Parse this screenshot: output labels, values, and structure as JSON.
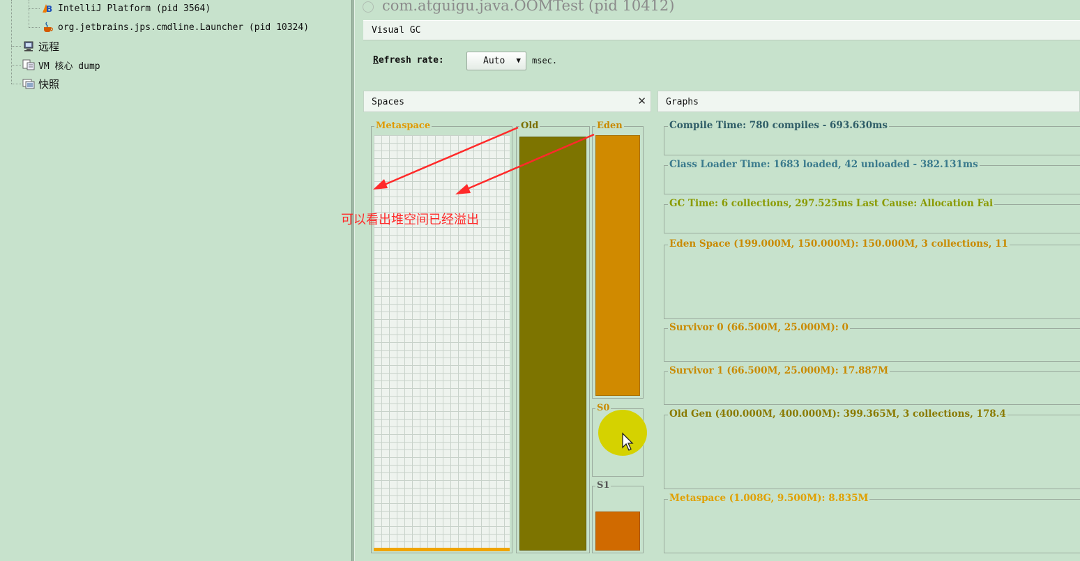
{
  "tree": {
    "items": [
      {
        "label": "IntelliJ Platform  (pid 3564)",
        "icon": "intellij-icon"
      },
      {
        "label": "org.jetbrains.jps.cmdline.Launcher  (pid 10324)",
        "icon": "java-cup-icon"
      },
      {
        "label": "远程",
        "icon": "remote-host-icon"
      },
      {
        "label": "VM 核心 dump",
        "icon": "core-dump-icon"
      },
      {
        "label": "快照",
        "icon": "snapshot-icon"
      }
    ]
  },
  "app": {
    "title": "com.atguigu.java.OOMTest  (pid 10412)",
    "tab": "Visual GC",
    "refresh": {
      "label_first": "R",
      "label_rest": "efresh rate:",
      "value": "Auto",
      "unit": "msec."
    }
  },
  "spaces": {
    "header": "Spaces",
    "close": "✕",
    "metaspace": {
      "label": "Metaspace",
      "fill_fraction": 0.01
    },
    "old": {
      "label": "Old",
      "fill_fraction": 1.0
    },
    "eden": {
      "label": "Eden",
      "fill_fraction": 1.0
    },
    "s0": {
      "label": "S0",
      "fill_fraction": 0.0
    },
    "s1": {
      "label": "S1",
      "fill_fraction": 0.72
    }
  },
  "graphs": {
    "header": "Graphs",
    "items": [
      {
        "label": "Compile Time: 780 compiles - 693.630ms",
        "color": "#2f5d67"
      },
      {
        "label": "Class Loader Time: 1683 loaded, 42 unloaded - 382.131ms",
        "color": "#3a7a8c"
      },
      {
        "label": "GC Time: 6 collections, 297.525ms Last Cause: Allocation Fai",
        "color": "#8a9a00"
      },
      {
        "label": "Eden Space (199.000M, 150.000M): 150.000M, 3 collections, 11",
        "color": "#c98a00"
      },
      {
        "label": "Survivor 0 (66.500M, 25.000M): 0",
        "color": "#c98a00"
      },
      {
        "label": "Survivor 1 (66.500M, 25.000M): 17.887M",
        "color": "#c98a00"
      },
      {
        "label": "Old Gen (400.000M, 400.000M): 399.365M, 3 collections, 178.4",
        "color": "#8a7a00"
      },
      {
        "label": "Metaspace (1.008G, 9.500M): 8.835M",
        "color": "#e0a000"
      }
    ]
  },
  "annotation": {
    "text": "可以看出堆空间已经溢出",
    "color": "#ff2a2a"
  },
  "colors": {
    "background": "#c7e2cc",
    "old_fill": "#7d7400",
    "eden_fill": "#d08a00",
    "s1_fill": "#d06a00",
    "metaspace_fill": "#f0a400"
  }
}
